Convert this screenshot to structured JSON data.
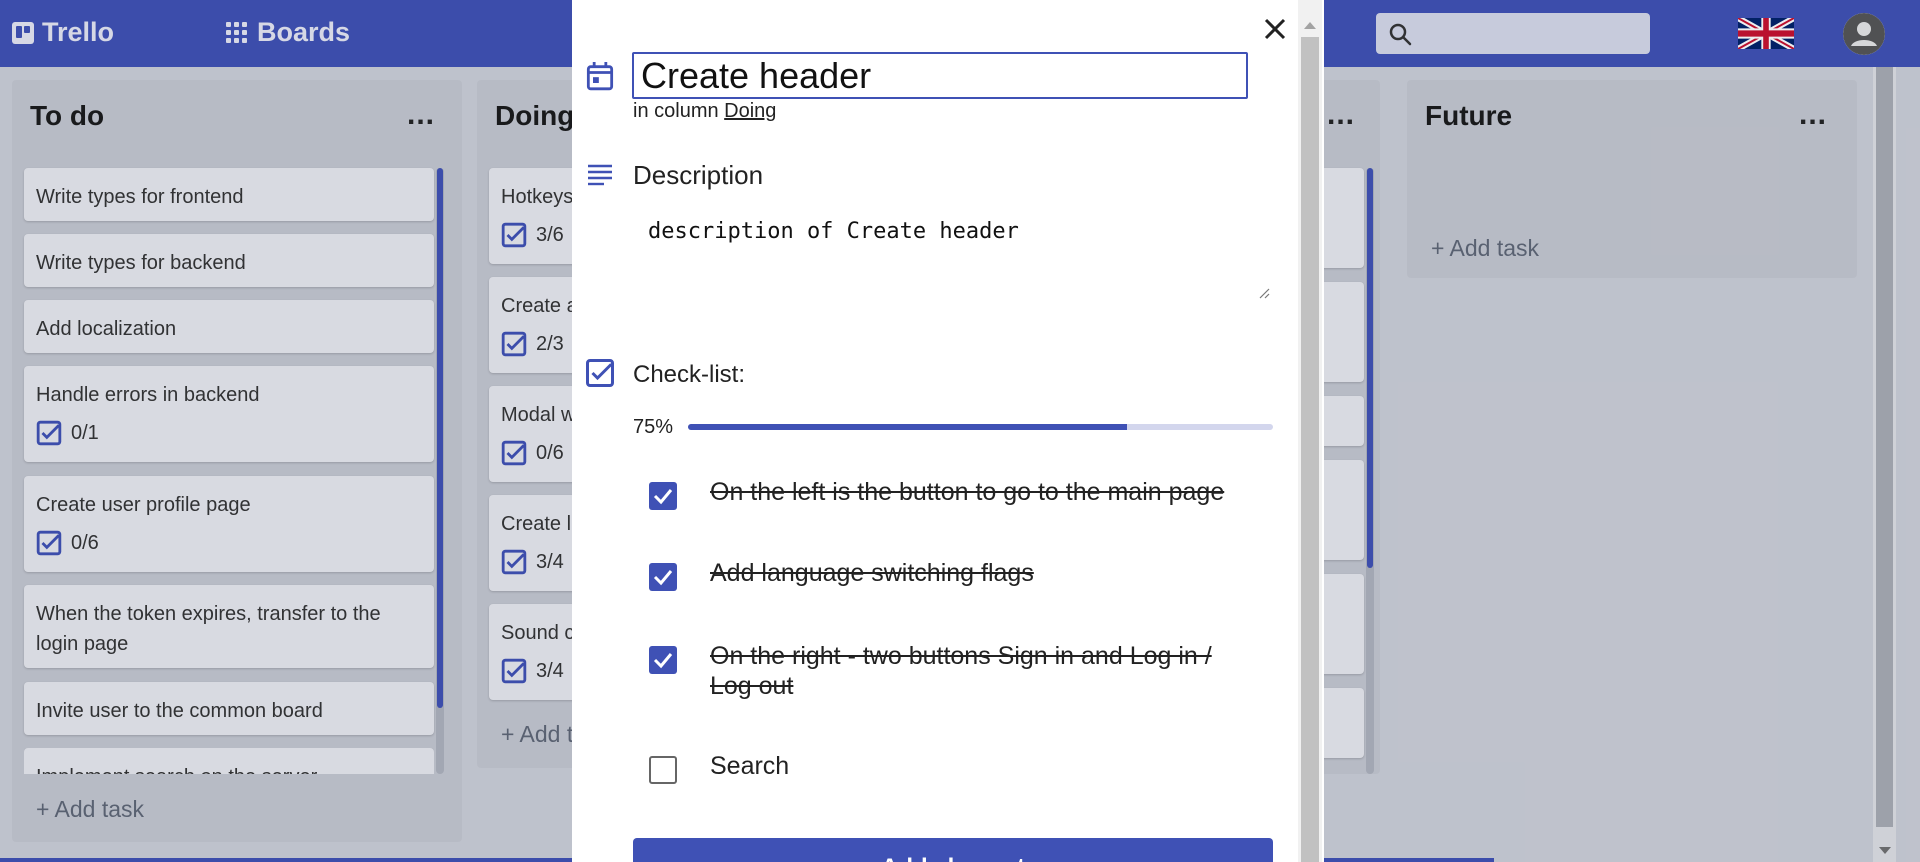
{
  "header": {
    "logo_text": "Trello",
    "boards_label": "Boards",
    "search_placeholder": "",
    "language_flag": "uk-flag-icon",
    "brand_color": "#3f51b5"
  },
  "columns": [
    {
      "title": "To do",
      "cards": [
        {
          "title": "Write types for frontend"
        },
        {
          "title": "Write types for backend"
        },
        {
          "title": "Add localization"
        },
        {
          "title": "Handle errors in backend",
          "checks": "0/1"
        },
        {
          "title": "Create user profile page",
          "checks": "0/6"
        },
        {
          "title": "When the token expires, transfer to the login page"
        },
        {
          "title": "Invite user to the common board"
        },
        {
          "title": "Implement search on the server"
        }
      ],
      "add_task": "+ Add task"
    },
    {
      "title": "Doing",
      "cards": [
        {
          "title": "Hotkeys",
          "checks": "3/6"
        },
        {
          "title": "Create a",
          "checks": "2/3"
        },
        {
          "title": "Modal w",
          "checks": "0/6"
        },
        {
          "title": "Create l",
          "checks": "3/4"
        },
        {
          "title": "Sound c",
          "checks": "3/4"
        }
      ],
      "add_task": "+ Add t"
    },
    {
      "title": "",
      "cards": []
    },
    {
      "title": "Future",
      "cards": [],
      "add_task": "+ Add task"
    }
  ],
  "modal": {
    "title_value": "Create header",
    "in_column_prefix": "in column",
    "column_name": "Doing",
    "description_label": "Description",
    "description_value": "description of Create header",
    "checklist_label": "Check-list:",
    "progress_text": "75%",
    "progress_value": 0.75,
    "items": [
      {
        "text": "On the left is the button to go to the main page",
        "done": true
      },
      {
        "text": "Add language switching flags",
        "done": true
      },
      {
        "text": "On the right - two buttons Sign in and Log in / Log out",
        "done": true
      },
      {
        "text": "Search",
        "done": false
      }
    ],
    "add_element_label": "Add element"
  }
}
